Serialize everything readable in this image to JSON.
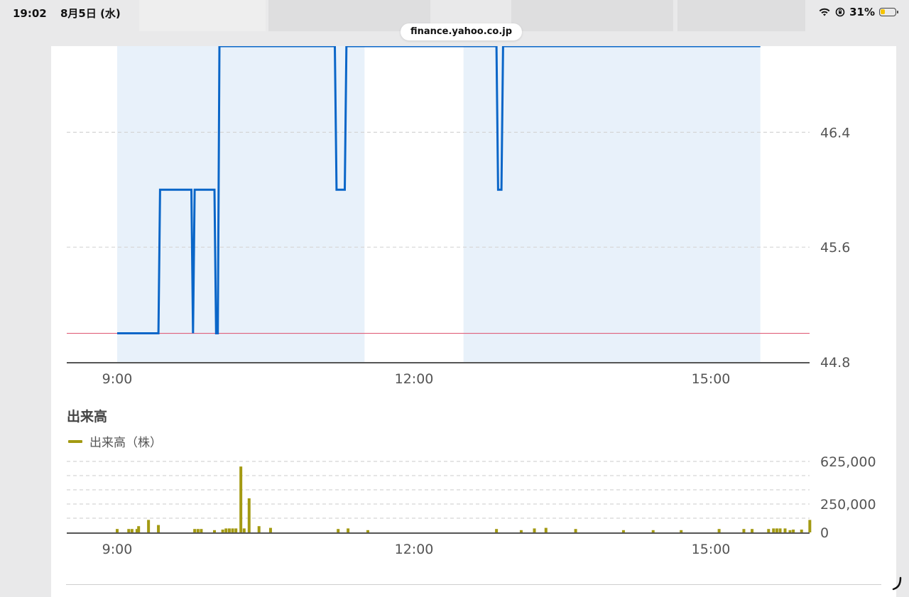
{
  "status_bar": {
    "time": "19:02",
    "date": "8月5日 (水)",
    "battery_percent": "31%",
    "battery_level": 0.31,
    "icons": [
      "wifi-icon",
      "lock-rotation-icon",
      "battery-icon"
    ]
  },
  "browser": {
    "url": "finance.yahoo.co.jp"
  },
  "colors": {
    "price_line": "#0a66c8",
    "prev_close_line": "#e0607a",
    "session_shade": "#e8f1fa",
    "volume_bar": "#a39a12",
    "axis": "#555555",
    "grid": "#d5d5d5"
  },
  "price_chart": {
    "y_ticks": [
      "46.4",
      "45.6",
      "44.8"
    ],
    "x_ticks": [
      "9:00",
      "12:00",
      "15:00"
    ]
  },
  "volume_section": {
    "title": "出来高",
    "legend_label": "出来高（株）",
    "y_ticks": [
      "625,000",
      "250,000",
      "0"
    ],
    "x_ticks": [
      "9:00",
      "12:00",
      "15:00"
    ]
  },
  "chart_data": [
    {
      "type": "line",
      "x_unit": "time",
      "ylim": [
        44.8,
        47.0
      ],
      "y_ticks": [
        44.8,
        45.6,
        46.4
      ],
      "x_ticks": [
        "9:00",
        "12:00",
        "15:00"
      ],
      "reference_line": {
        "y": 45.0
      },
      "sessions": [
        [
          "9:00",
          "11:30"
        ],
        [
          "12:30",
          "15:30"
        ]
      ],
      "grid": true,
      "series": [
        {
          "x": [
            "9:00",
            "9:25",
            "9:26",
            "9:45",
            "9:46",
            "9:47",
            "9:48",
            "9:59",
            "10:00",
            "10:01",
            "10:02",
            "10:03",
            "11:12",
            "11:13",
            "11:18",
            "11:19",
            "12:50",
            "12:51",
            "12:53",
            "12:54",
            "15:30"
          ],
          "y": [
            45.0,
            45.0,
            46.0,
            46.0,
            45.0,
            46.0,
            46.0,
            46.0,
            45.0,
            45.0,
            47.0,
            47.0,
            47.0,
            46.0,
            46.0,
            47.0,
            47.0,
            46.0,
            46.0,
            47.0,
            47.0
          ]
        }
      ]
    },
    {
      "type": "bar",
      "x_unit": "time",
      "ylim": [
        0,
        625000
      ],
      "y_ticks": [
        0,
        250000,
        625000
      ],
      "x_ticks": [
        "9:00",
        "12:00",
        "15:00"
      ],
      "grid": true,
      "series": [
        {
          "x": [
            "9:00",
            "9:07",
            "9:09",
            "9:12",
            "9:13",
            "9:19",
            "9:25",
            "9:47",
            "9:49",
            "9:51",
            "9:59",
            "10:04",
            "10:06",
            "10:08",
            "10:10",
            "10:12",
            "10:15",
            "10:17",
            "10:20",
            "10:26",
            "10:33",
            "11:14",
            "11:20",
            "11:32",
            "12:50",
            "13:05",
            "13:13",
            "13:20",
            "13:38",
            "14:07",
            "14:25",
            "14:42",
            "15:05",
            "15:20",
            "15:25",
            "15:35",
            "15:38",
            "15:40",
            "15:42",
            "15:45",
            "15:48",
            "15:50",
            "15:55",
            "16:00"
          ],
          "y": [
            30000,
            30000,
            30000,
            30000,
            55000,
            110000,
            65000,
            30000,
            30000,
            30000,
            20000,
            25000,
            35000,
            35000,
            35000,
            35000,
            580000,
            35000,
            300000,
            55000,
            40000,
            30000,
            35000,
            20000,
            30000,
            20000,
            35000,
            40000,
            30000,
            20000,
            20000,
            20000,
            30000,
            30000,
            30000,
            30000,
            35000,
            35000,
            35000,
            35000,
            20000,
            25000,
            25000,
            110000
          ]
        }
      ]
    }
  ]
}
